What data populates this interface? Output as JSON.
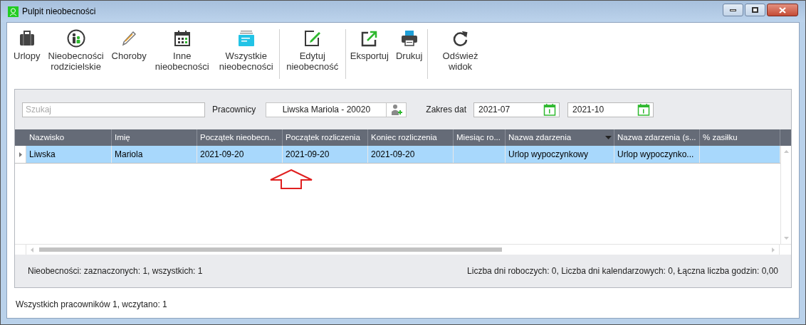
{
  "window": {
    "title": "Pulpit nieobecności"
  },
  "toolbar": {
    "groups": [
      [
        {
          "label": "Urlopy"
        },
        {
          "label": "Nieobecności rodzicielskie"
        },
        {
          "label": "Choroby"
        },
        {
          "label": "Inne nieobecności"
        },
        {
          "label": "Wszystkie nieobecności"
        }
      ],
      [
        {
          "label": "Edytuj nieobecność"
        }
      ],
      [
        {
          "label": "Eksportuj"
        },
        {
          "label": "Drukuj"
        }
      ],
      [
        {
          "label": "Odśwież widok"
        }
      ]
    ]
  },
  "filters": {
    "search": {
      "placeholder": "Szukaj"
    },
    "employees_label": "Pracownicy",
    "employee": "Liwska Mariola - 20020",
    "date_range_label": "Zakres dat",
    "date_from": "2021-07",
    "date_to": "2021-10"
  },
  "table": {
    "columns": [
      {
        "label": "Nazwisko",
        "sorted": false
      },
      {
        "label": "Imię",
        "sorted": false
      },
      {
        "label": "Początek nieobecn...",
        "sorted": false
      },
      {
        "label": "Początek rozliczenia",
        "sorted": false
      },
      {
        "label": "Koniec rozliczenia",
        "sorted": false
      },
      {
        "label": "Miesiąc ro...",
        "sorted": false
      },
      {
        "label": "Nazwa zdarzenia",
        "sorted": true
      },
      {
        "label": "Nazwa zdarzenia (s...",
        "sorted": false
      },
      {
        "label": "% zasiłku",
        "sorted": false
      }
    ],
    "rows": [
      {
        "selected": true,
        "cells": [
          "Liwska",
          "Mariola",
          "2021-09-20",
          "2021-09-20",
          "2021-09-20",
          "",
          "Urlop wypoczynkowy",
          "Urlop wypoczynko...",
          ""
        ]
      }
    ]
  },
  "summary_left": "Nieobecności: zaznaczonych: 1, wszystkich: 1",
  "summary_right": "Liczba dni roboczych: 0, Liczba dni kalendarzowych: 0, Łączna liczba godzin: 0,00",
  "status_bar": "Wszystkich pracowników 1, wczytano: 1"
}
